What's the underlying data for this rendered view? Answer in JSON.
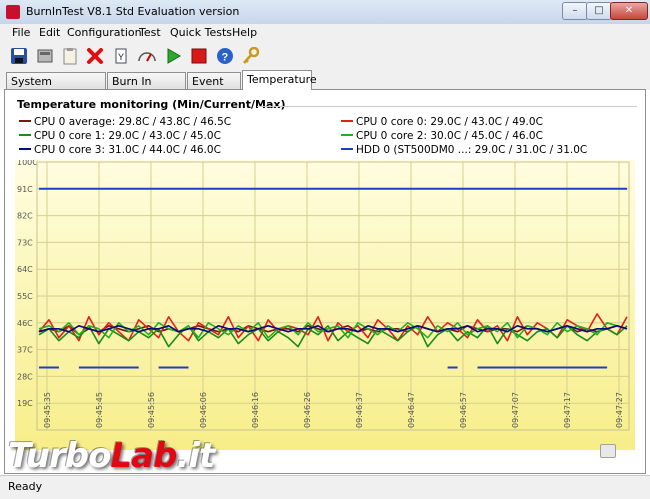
{
  "window": {
    "title": "BurnInTest V8.1 Std Evaluation version",
    "min": "–",
    "max": "□",
    "close": "✕"
  },
  "menu": [
    "File",
    "Edit",
    "Configuration",
    "Test",
    "Quick Tests",
    "Help"
  ],
  "toolbar": [
    "save-icon",
    "disk-icon",
    "clipboard-icon",
    "stop-red-x-icon",
    "report-icon",
    "gauge-icon",
    "play-icon",
    "stop-square-icon",
    "help-icon",
    "key-icon"
  ],
  "tabs": [
    "System Information",
    "Burn In Results",
    "Event Log",
    "Temperature"
  ],
  "active_tab": "Temperature",
  "section_title": "Temperature monitoring  (Min/Current/Max)",
  "legend": [
    {
      "label": "CPU 0 average: 29.8C / 43.8C / 46.5C",
      "color": "#7a1515"
    },
    {
      "label": "CPU 0 core 0: 29.0C / 43.0C / 49.0C",
      "color": "#e2201c"
    },
    {
      "label": "CPU 0 core 1: 29.0C / 43.0C / 45.0C",
      "color": "#1a8a1a"
    },
    {
      "label": "CPU 0 core 2: 30.0C / 45.0C / 46.0C",
      "color": "#22b022"
    },
    {
      "label": "CPU 0 core 3: 31.0C / 44.0C / 46.0C",
      "color": "#0a0a80"
    },
    {
      "label": "HDD 0 (ST500DM0 ...: 29.0C / 31.0C / 31.0C",
      "color": "#1c3ec8"
    }
  ],
  "chart_data": {
    "type": "line",
    "y_ticks": [
      "100C",
      "91C",
      "82C",
      "73C",
      "64C",
      "55C",
      "46C",
      "37C",
      "28C",
      "19C"
    ],
    "x_ticks": [
      "09:45:35",
      "09:45:45",
      "09:45:56",
      "09:46:06",
      "09:46:16",
      "09:46:26",
      "09:46:37",
      "09:46:47",
      "09:46:57",
      "09:47:07",
      "09:47:17",
      "09:47:27"
    ],
    "ylim": [
      10,
      100
    ],
    "background": [
      "#fffde0",
      "#f7ee88"
    ],
    "grid": true,
    "series": [
      {
        "name": "CPU 0 average",
        "color": "#7a1515",
        "values": [
          43,
          44,
          43,
          45,
          42,
          44,
          43,
          45,
          44,
          43,
          44,
          45,
          43,
          44,
          43,
          44,
          45,
          44,
          43,
          44,
          43,
          45,
          44,
          43,
          44,
          44,
          43,
          45,
          44,
          43,
          44,
          45,
          43,
          44,
          43,
          44,
          44,
          43,
          45,
          44,
          43,
          44,
          43,
          45,
          44,
          43,
          44,
          44,
          43,
          45,
          44,
          43,
          44,
          45,
          43,
          44,
          43,
          44,
          45,
          44
        ]
      },
      {
        "name": "CPU 0 core 0",
        "color": "#e2201c",
        "values": [
          43,
          47,
          41,
          45,
          40,
          48,
          42,
          46,
          43,
          40,
          47,
          44,
          41,
          48,
          43,
          40,
          46,
          44,
          42,
          48,
          41,
          45,
          40,
          47,
          43,
          45,
          44,
          42,
          48,
          40,
          46,
          43,
          45,
          41,
          47,
          44,
          40,
          45,
          42,
          48,
          43,
          46,
          44,
          41,
          47,
          43,
          45,
          40,
          48,
          42,
          46,
          44,
          41,
          47,
          45,
          43,
          49,
          44,
          42,
          48
        ]
      },
      {
        "name": "CPU 0 core 1",
        "color": "#1a8a1a",
        "values": [
          42,
          44,
          40,
          43,
          41,
          45,
          39,
          44,
          42,
          40,
          43,
          41,
          44,
          38,
          42,
          45,
          40,
          43,
          41,
          44,
          39,
          42,
          44,
          40,
          43,
          41,
          38,
          44,
          42,
          45,
          40,
          43,
          41,
          39,
          44,
          42,
          40,
          43,
          45,
          38,
          42,
          44,
          40,
          43,
          41,
          45,
          39,
          44,
          42,
          40,
          43,
          44,
          41,
          45,
          42,
          40,
          43,
          44,
          42,
          45
        ]
      },
      {
        "name": "CPU 0 core 2",
        "color": "#22b022",
        "values": [
          44,
          45,
          43,
          46,
          42,
          45,
          44,
          41,
          46,
          43,
          45,
          42,
          46,
          44,
          43,
          45,
          41,
          46,
          44,
          42,
          45,
          43,
          46,
          41,
          44,
          45,
          42,
          46,
          43,
          44,
          45,
          41,
          46,
          44,
          42,
          45,
          43,
          46,
          44,
          41,
          45,
          43,
          46,
          42,
          44,
          45,
          43,
          46,
          41,
          45,
          44,
          42,
          46,
          43,
          45,
          44,
          42,
          46,
          45,
          44
        ]
      },
      {
        "name": "CPU 0 core 3",
        "color": "#0a0a80",
        "values": [
          43,
          44,
          44,
          43,
          45,
          44,
          43,
          44,
          45,
          44,
          43,
          44,
          44,
          45,
          43,
          44,
          44,
          43,
          45,
          44,
          44,
          43,
          44,
          45,
          44,
          43,
          44,
          44,
          45,
          43,
          44,
          44,
          43,
          45,
          44,
          44,
          43,
          44,
          45,
          44,
          43,
          44,
          44,
          45,
          43,
          44,
          44,
          43,
          45,
          44,
          44,
          43,
          44,
          45,
          44,
          43,
          44,
          44,
          45,
          44
        ]
      },
      {
        "name": "HDD 0 (ST500DM0 ...",
        "color": "#1c3ec8",
        "values": [
          31,
          31,
          31,
          null,
          31,
          31,
          31,
          31,
          31,
          31,
          31,
          null,
          31,
          31,
          31,
          31,
          null,
          31,
          null,
          null,
          null,
          null,
          null,
          null,
          null,
          null,
          null,
          null,
          null,
          null,
          null,
          null,
          null,
          null,
          null,
          null,
          null,
          null,
          null,
          null,
          null,
          31,
          31,
          null,
          31,
          31,
          31,
          31,
          31,
          31,
          31,
          31,
          31,
          31,
          31,
          31,
          31,
          31,
          null,
          31
        ]
      },
      {
        "name": "HDD top",
        "color": "#1c3ec8",
        "values": [
          91,
          91,
          91,
          91,
          91,
          91,
          91,
          91,
          91,
          91,
          91,
          91,
          91,
          91,
          91,
          91,
          91,
          91,
          91,
          91,
          91,
          91,
          91,
          91,
          91,
          91,
          91,
          91,
          91,
          91,
          91,
          91,
          91,
          91,
          91,
          91,
          91,
          91,
          91,
          91,
          91,
          91,
          91,
          91,
          91,
          91,
          91,
          91,
          91,
          91,
          91,
          91,
          91,
          91,
          91,
          91,
          91,
          91,
          91,
          91
        ]
      }
    ]
  },
  "status": "Ready",
  "watermark": {
    "a": "Turbo",
    "b": "Lab",
    "c": ".it"
  }
}
